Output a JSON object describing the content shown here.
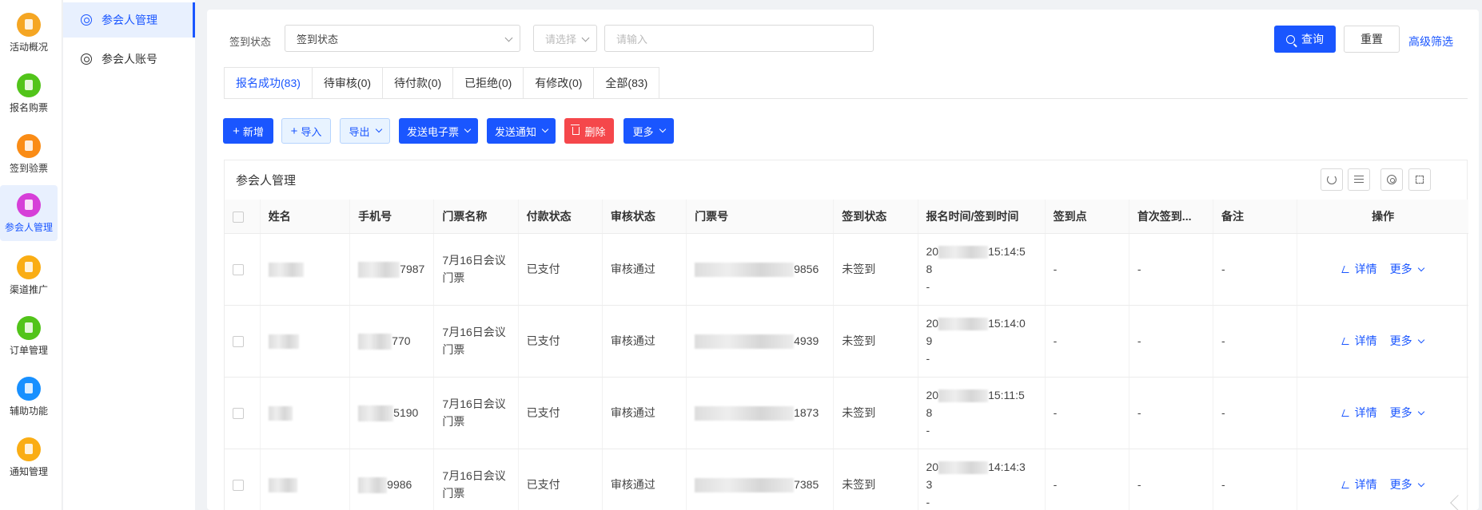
{
  "rail": {
    "items": [
      {
        "label": "活动概况",
        "color": "#f5a623"
      },
      {
        "label": "报名购票",
        "color": "#52c41a"
      },
      {
        "label": "签到验票",
        "color": "#fa8c16"
      },
      {
        "label": "参会人管理",
        "color": "#d63fd8"
      },
      {
        "label": "渠道推广",
        "color": "#faad14"
      },
      {
        "label": "订单管理",
        "color": "#52c41a"
      },
      {
        "label": "辅助功能",
        "color": "#1890ff"
      },
      {
        "label": "通知管理",
        "color": "#faad14"
      }
    ],
    "active_index": 3
  },
  "subnav": {
    "items": [
      {
        "label": "参会人管理"
      },
      {
        "label": "参会人账号"
      }
    ]
  },
  "filter": {
    "label": "签到状态",
    "status_select": "签到状态",
    "option_select_placeholder": "请选择",
    "text_input_placeholder": "请输入",
    "query_label": "查询",
    "reset_label": "重置",
    "advanced_label": "高级筛选"
  },
  "tabs": [
    {
      "label": "报名成功(83)"
    },
    {
      "label": "待审核(0)"
    },
    {
      "label": "待付款(0)"
    },
    {
      "label": "已拒绝(0)"
    },
    {
      "label": "有修改(0)"
    },
    {
      "label": "全部(83)"
    }
  ],
  "actions": {
    "add": "新增",
    "import": "导入",
    "export": "导出",
    "send_ticket": "发送电子票",
    "send_notice": "发送通知",
    "delete": "删除",
    "more": "更多"
  },
  "table": {
    "title": "参会人管理",
    "columns": [
      "姓名",
      "手机号",
      "门票名称",
      "付款状态",
      "审核状态",
      "门票号",
      "签到状态",
      "报名时间/签到时间",
      "签到点",
      "首次签到...",
      "备注",
      "操作"
    ],
    "rows": [
      {
        "phone_tail": "7987",
        "ticket_name": "7月16日会议门票",
        "pay": "已支付",
        "review": "审核通过",
        "ticket_tail": "9856",
        "checkin": "未签到",
        "time_prefix": "20",
        "time_tail": "15:14:5",
        "time_line2": "8",
        "time_line3": "-",
        "point": "-",
        "first": "-",
        "note": "-",
        "detail": "详情",
        "more": "更多"
      },
      {
        "phone_tail": "770",
        "ticket_name": "7月16日会议门票",
        "pay": "已支付",
        "review": "审核通过",
        "ticket_tail": "4939",
        "checkin": "未签到",
        "time_prefix": "20",
        "time_tail": "15:14:0",
        "time_line2": "9",
        "time_line3": "-",
        "point": "-",
        "first": "-",
        "note": "-",
        "detail": "详情",
        "more": "更多"
      },
      {
        "phone_tail": "5190",
        "ticket_name": "7月16日会议门票",
        "pay": "已支付",
        "review": "审核通过",
        "ticket_tail": "1873",
        "checkin": "未签到",
        "time_prefix": "20",
        "time_tail": "15:11:5",
        "time_line2": "8",
        "time_line3": "-",
        "point": "-",
        "first": "-",
        "note": "-",
        "detail": "详情",
        "more": "更多"
      },
      {
        "phone_tail": "9986",
        "ticket_name": "7月16日会议门票",
        "pay": "已支付",
        "review": "审核通过",
        "ticket_tail": "7385",
        "checkin": "未签到",
        "time_prefix": "20",
        "time_tail": "14:14:3",
        "time_line2": "3",
        "time_line3": "-",
        "point": "-",
        "first": "-",
        "note": "-",
        "detail": "详情",
        "more": "更多"
      }
    ]
  },
  "colors": {
    "primary": "#1a56ff",
    "danger": "#f5474b",
    "active_bg": "#e8f0fe"
  }
}
